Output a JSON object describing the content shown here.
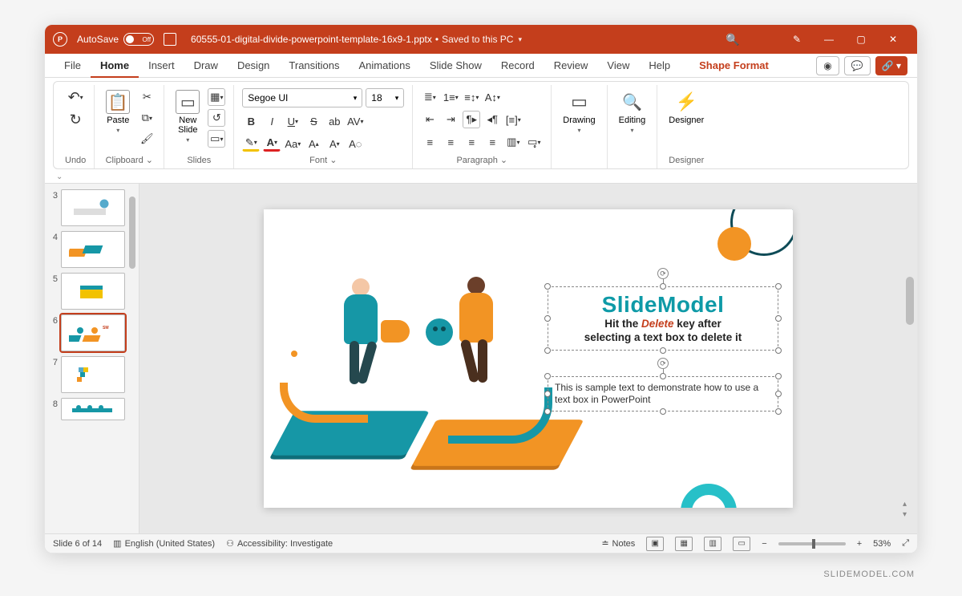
{
  "titlebar": {
    "autosave_label": "AutoSave",
    "autosave_state": "Off",
    "filename": "60555-01-digital-divide-powerpoint-template-16x9-1.pptx",
    "save_status": "Saved to this PC"
  },
  "tabs": {
    "items": [
      "File",
      "Home",
      "Insert",
      "Draw",
      "Design",
      "Transitions",
      "Animations",
      "Slide Show",
      "Record",
      "Review",
      "View",
      "Help"
    ],
    "context": "Shape Format",
    "active_index": 1
  },
  "ribbon": {
    "undo": {
      "label": "Undo"
    },
    "clipboard": {
      "label": "Clipboard",
      "paste": "Paste"
    },
    "slides": {
      "label": "Slides",
      "newslide": "New\nSlide"
    },
    "font": {
      "label": "Font",
      "family": "Segoe UI",
      "size": "18"
    },
    "paragraph": {
      "label": "Paragraph"
    },
    "drawing": {
      "label": "Drawing",
      "btn": "Drawing"
    },
    "editing": {
      "label": "Editing",
      "btn": "Editing"
    },
    "designer": {
      "label": "Designer",
      "btn": "Designer"
    }
  },
  "thumbnails": [
    {
      "num": "3"
    },
    {
      "num": "4"
    },
    {
      "num": "5"
    },
    {
      "num": "6",
      "selected": true
    },
    {
      "num": "7"
    },
    {
      "num": "8"
    }
  ],
  "slide": {
    "title": "SlideModel",
    "subtitle_pre": "Hit the ",
    "subtitle_em": "Delete",
    "subtitle_mid": " key after",
    "subtitle_line2": "selecting a text box to delete it",
    "sample": "This is sample text to demonstrate how to use a text box in PowerPoint"
  },
  "status": {
    "slide_pos": "Slide 6 of 14",
    "language": "English (United States)",
    "accessibility": "Accessibility: Investigate",
    "notes": "Notes",
    "zoom_pct": "53%"
  },
  "watermark": "SLIDEMODEL.COM"
}
